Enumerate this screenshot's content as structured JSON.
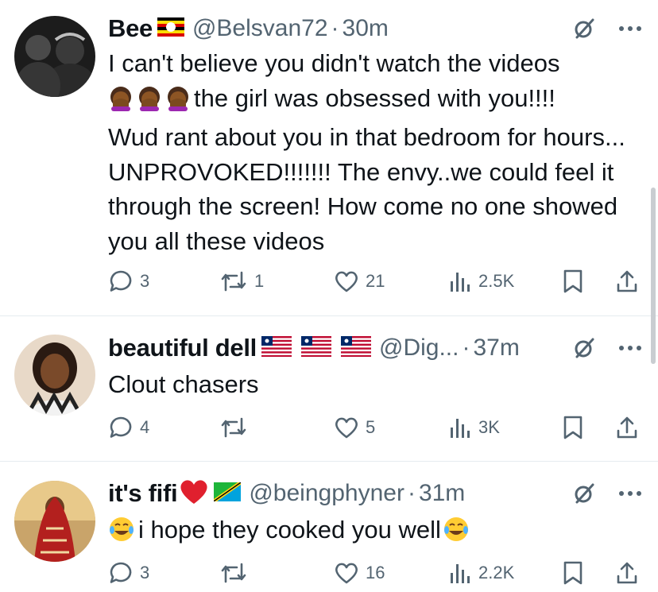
{
  "tweets": [
    {
      "name": "Bee",
      "handle": "@Belsvan72",
      "time": "30m",
      "flags": [
        "uganda-flag"
      ],
      "text_line1": "I can't believe you didn't watch the videos",
      "text_line2_after_emoji": "the girl was obsessed with you!!!!",
      "text_rest": "Wud rant about you in that bedroom for hours... UNPROVOKED!!!!!!! The envy..we could feel it through the screen! How come no one showed you all these videos",
      "emoji_prefix": [
        "face-palm-emoji",
        "face-palm-emoji",
        "face-palm-emoji"
      ],
      "replies": "3",
      "reposts": "1",
      "likes": "21",
      "views": "2.5K"
    },
    {
      "name": "beautiful dell",
      "handle": "@Dig...",
      "time": "37m",
      "flags": [
        "liberia-flag",
        "liberia-flag",
        "liberia-flag"
      ],
      "text": "Clout chasers",
      "replies": "4",
      "reposts": "",
      "likes": "5",
      "views": "3K"
    },
    {
      "name": "it's fifi",
      "handle": "@beingphyner",
      "time": "31m",
      "flags": [
        "red-heart-emoji",
        "tanzania-flag"
      ],
      "text": "i hope they cooked you well",
      "emoji_prefix": [
        "tears-of-joy-emoji"
      ],
      "emoji_suffix": [
        "tears-of-joy-emoji"
      ],
      "replies": "3",
      "reposts": "",
      "likes": "16",
      "views": "2.2K"
    }
  ],
  "dot": "·",
  "colors": {
    "text": "#0f1419",
    "secondary": "#536471",
    "divider": "#e6ecf0"
  }
}
